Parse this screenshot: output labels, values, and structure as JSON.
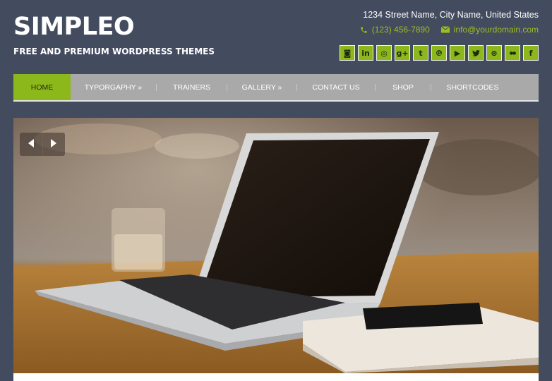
{
  "site": {
    "title": "SIMPLEO",
    "tagline": "FREE AND PREMIUM WORDPRESS THEMES"
  },
  "contact": {
    "address": "1234 Street Name, City Name, United States",
    "phone": "(123) 456-7890",
    "email": "info@yourdomain.com"
  },
  "socials": [
    {
      "name": "instagram",
      "glyph": "◙"
    },
    {
      "name": "linkedin",
      "glyph": "in"
    },
    {
      "name": "dribbble",
      "glyph": "◎"
    },
    {
      "name": "google-plus",
      "glyph": "g+"
    },
    {
      "name": "tumblr",
      "glyph": "t"
    },
    {
      "name": "pinterest",
      "glyph": "℗"
    },
    {
      "name": "youtube",
      "glyph": "▶"
    },
    {
      "name": "twitter",
      "glyph": "🐦"
    },
    {
      "name": "rss",
      "glyph": "⊛"
    },
    {
      "name": "flickr",
      "glyph": "●●"
    },
    {
      "name": "facebook",
      "glyph": "f"
    }
  ],
  "nav": [
    {
      "label": "HOME",
      "active": true
    },
    {
      "label": "TYPORGAPHY »",
      "active": false
    },
    {
      "label": "TRAINERS",
      "active": false
    },
    {
      "label": "GALLERY »",
      "active": false
    },
    {
      "label": "CONTACT US",
      "active": false
    },
    {
      "label": "SHOP",
      "active": false
    },
    {
      "label": "SHORTCODES",
      "active": false
    }
  ],
  "colors": {
    "background": "#434b5e",
    "accent": "#8db81c",
    "nav": "#a9a9a9"
  },
  "icons": {
    "phone": "phone-icon",
    "email": "envelope-icon",
    "prev": "chevron-left-icon",
    "next": "chevron-right-icon"
  }
}
